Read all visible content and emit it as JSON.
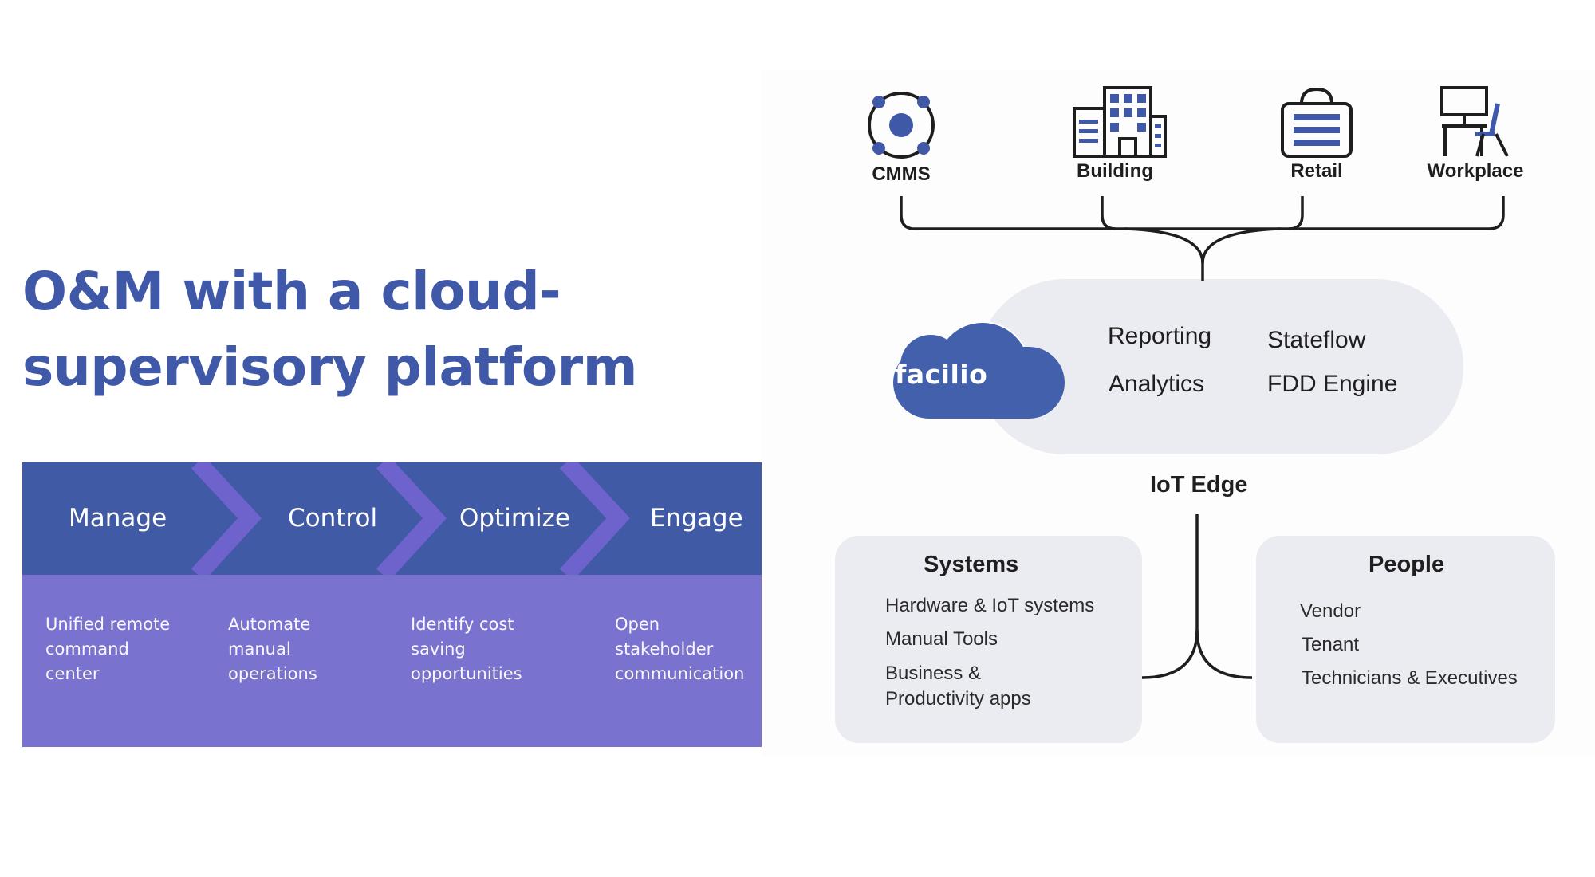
{
  "title": {
    "line1": "O&M with a cloud-",
    "line2": "supervisory platform"
  },
  "steps": [
    {
      "label": "Manage",
      "desc": "Unified remote\ncommand\ncenter"
    },
    {
      "label": "Control",
      "desc": "Automate\nmanual\noperations"
    },
    {
      "label": "Optimize",
      "desc": "Identify cost\nsaving\nopportunities"
    },
    {
      "label": "Engage",
      "desc": "Open\nstakeholder\ncommunication"
    }
  ],
  "diagram": {
    "icons": [
      {
        "label": "CMMS",
        "icon": "cmms-icon"
      },
      {
        "label": "Building",
        "icon": "building-icon"
      },
      {
        "label": "Retail",
        "icon": "retail-icon"
      },
      {
        "label": "Workplace",
        "icon": "workplace-icon"
      }
    ],
    "brand": "facilio",
    "features": [
      "Reporting",
      "Stateflow",
      "Analytics",
      "FDD Engine"
    ],
    "iot_edge": "IoT Edge",
    "systems": {
      "title": "Systems",
      "items": [
        "Hardware & IoT systems",
        "Manual Tools",
        "Business &\nProductivity apps"
      ]
    },
    "people": {
      "title": "People",
      "items": [
        "Vendor",
        "Tenant",
        "Technicians & Executives"
      ]
    }
  },
  "colors": {
    "title": "#3f59a8",
    "band_top": "#405aa5",
    "band_bottom": "#7a72cf",
    "chevron": "#6e63cc",
    "icon_blue": "#3f59a8",
    "cloud": "#4360ad",
    "panel": "#ebebf2"
  }
}
